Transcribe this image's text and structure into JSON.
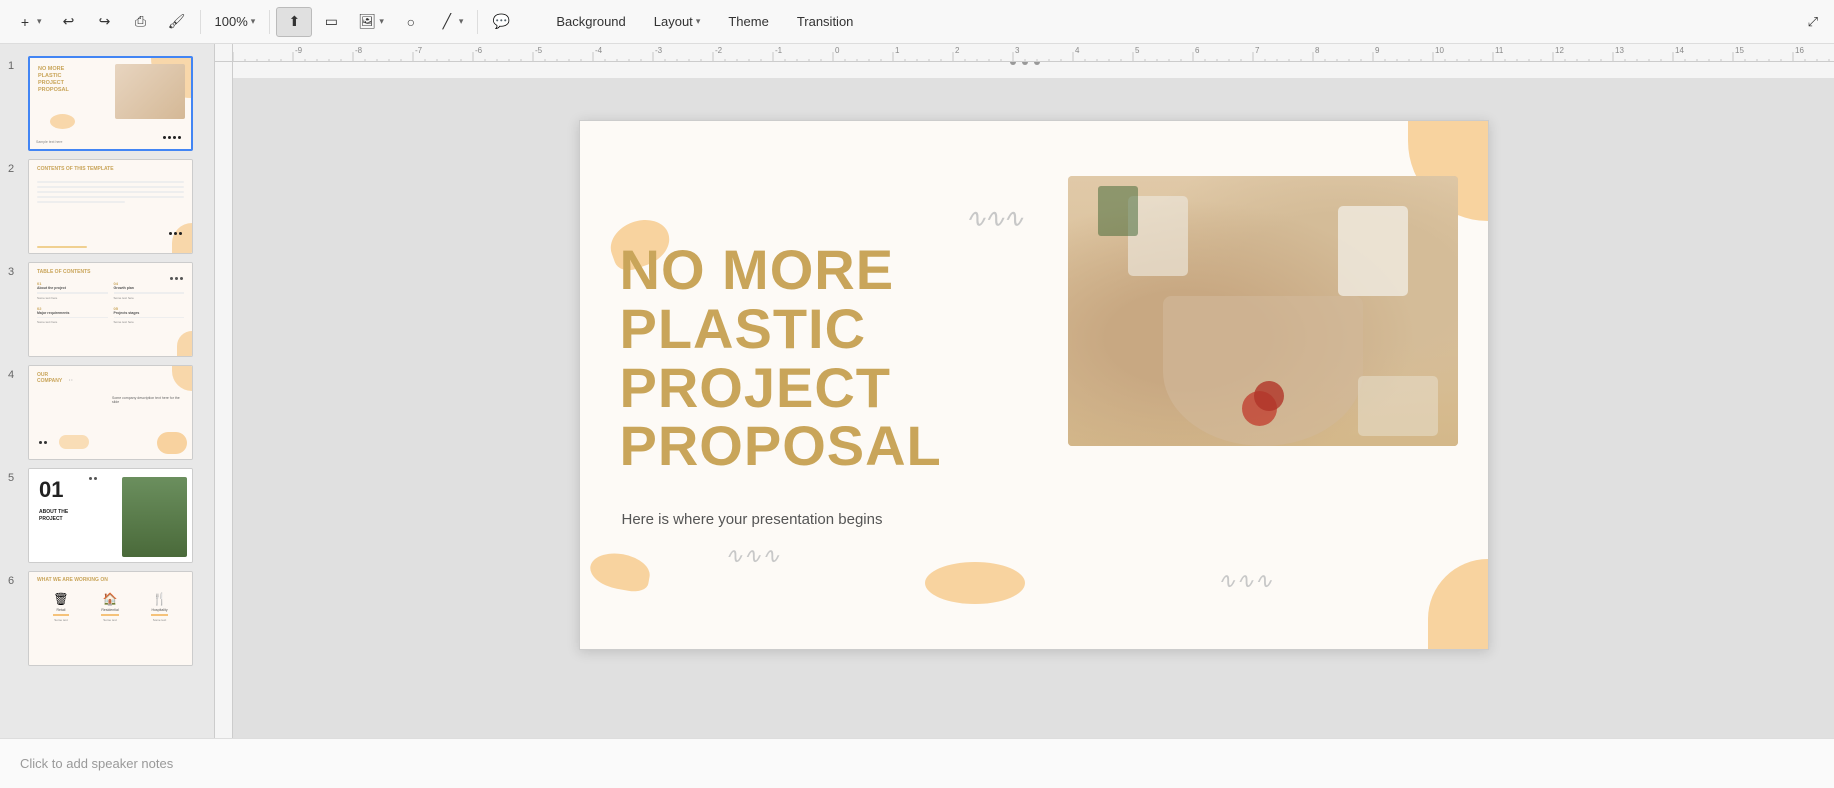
{
  "toolbar": {
    "add_label": "+",
    "undo_label": "↩",
    "redo_label": "↪",
    "print_label": "🖨",
    "paintformat_label": "🖌",
    "zoom_label": "100%",
    "select_label": "▲",
    "text_label": "T",
    "image_label": "🖼",
    "shape_label": "○",
    "line_label": "╱",
    "comment_label": "💬",
    "background_label": "Background",
    "layout_label": "Layout",
    "layout_arrow": "▾",
    "theme_label": "Theme",
    "transition_label": "Transition",
    "fullscreen_label": "⤢"
  },
  "slides": [
    {
      "number": "1",
      "active": true
    },
    {
      "number": "2",
      "active": false
    },
    {
      "number": "3",
      "active": false
    },
    {
      "number": "4",
      "active": false
    },
    {
      "number": "5",
      "active": false
    },
    {
      "number": "6",
      "active": false
    }
  ],
  "slide1": {
    "title_line1": "NO MORE",
    "title_line2": "PLASTIC",
    "title_line3": "PROJECT",
    "title_line4": "PROPOSAL",
    "subtitle": "Here is where your presentation begins"
  },
  "bottom_dots": [
    "•",
    "•",
    "•"
  ],
  "speaker_notes": "Click to add speaker notes",
  "colors": {
    "accent_orange": "#f5c27a",
    "title_gold": "#c9a55a",
    "bg_cream": "#fdfaf6",
    "dark": "#222222",
    "gray_wave": "#c8c8c8"
  }
}
